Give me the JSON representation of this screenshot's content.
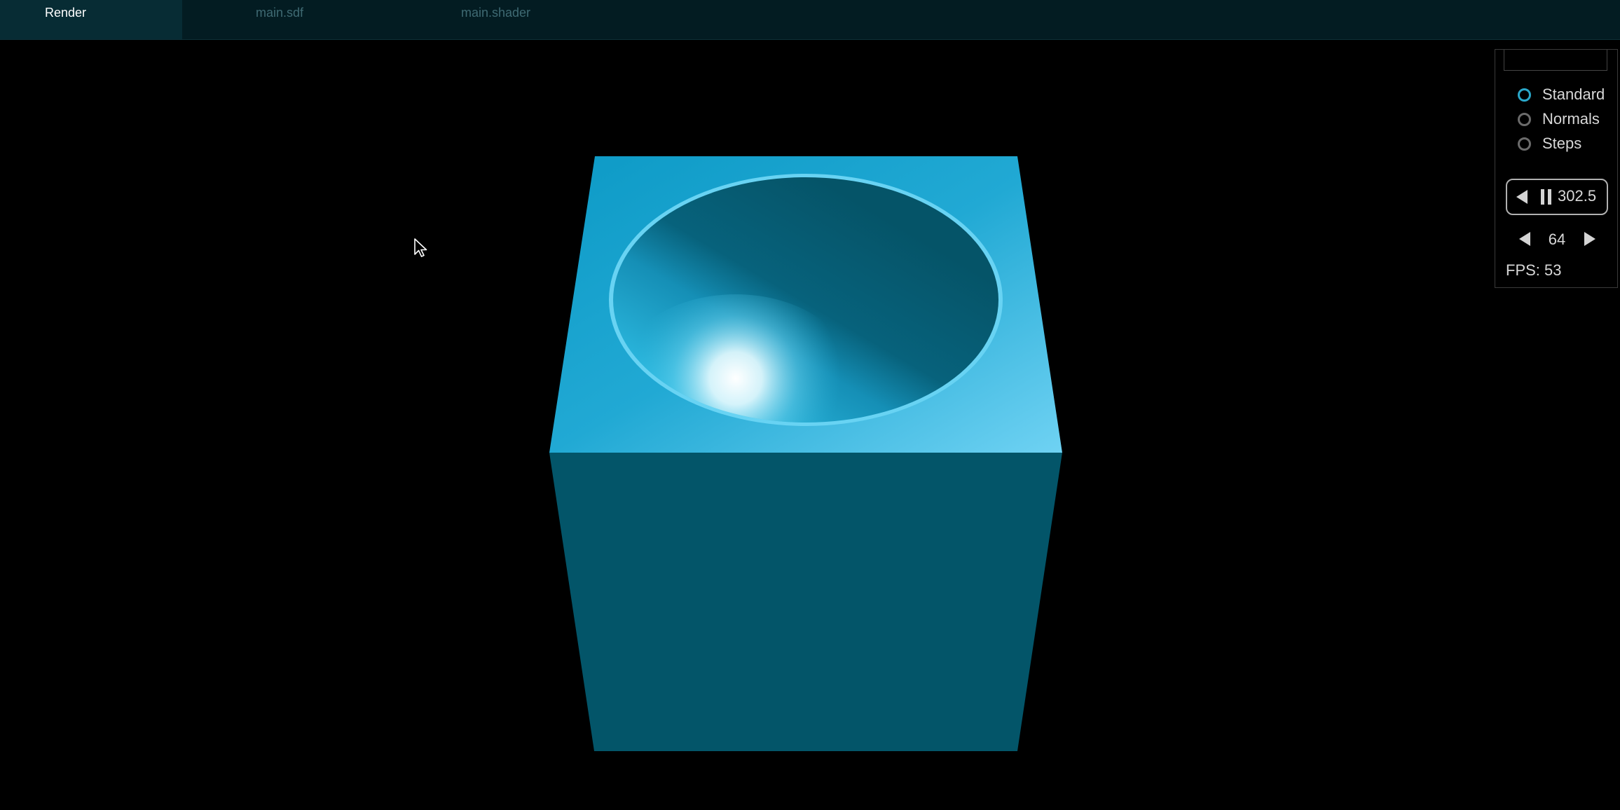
{
  "tabs": [
    {
      "label": "Render",
      "active": true
    },
    {
      "label": "main.sdf",
      "active": false
    },
    {
      "label": "main.shader",
      "active": false
    }
  ],
  "panel": {
    "render_modes": [
      {
        "label": "Standard",
        "selected": true
      },
      {
        "label": "Normals",
        "selected": false
      },
      {
        "label": "Steps",
        "selected": false
      }
    ],
    "time": "302.5",
    "steps": "64",
    "fps": "FPS: 53"
  },
  "colors": {
    "tab_bar": "#031c22",
    "active_tab": "#072c34",
    "cube_top": "#23a9d3",
    "cube_front": "#035569",
    "accent": "#2aa7c9"
  }
}
